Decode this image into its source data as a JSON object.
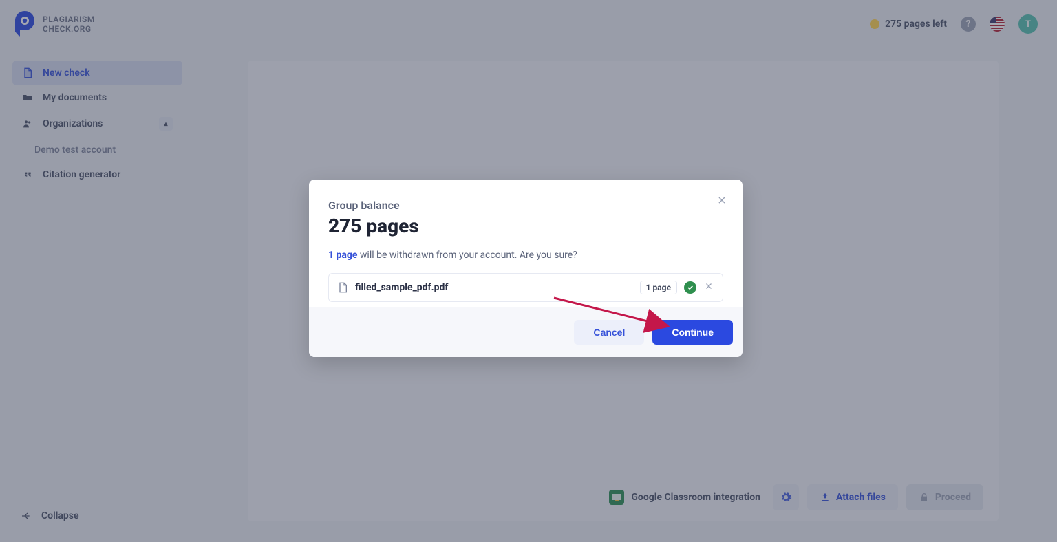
{
  "header": {
    "brand_line1": "PLAGIARISM",
    "brand_line2": "CHECK.ORG",
    "pages_left": "275 pages left",
    "avatar_initial": "T"
  },
  "sidebar": {
    "new_check": "New check",
    "my_documents": "My documents",
    "organizations": "Organizations",
    "demo_account": "Demo test account",
    "citation_generator": "Citation generator",
    "collapse": "Collapse"
  },
  "bottom": {
    "gc_label": "Google Classroom integration",
    "attach": "Attach files",
    "proceed": "Proceed"
  },
  "modal": {
    "subtitle": "Group balance",
    "title": "275 pages",
    "hl": "1 page",
    "msg_rest": " will be withdrawn from your account. Are you sure?",
    "file_name": "filled_sample_pdf.pdf",
    "page_badge": "1 page",
    "cancel": "Cancel",
    "continue": "Continue"
  }
}
